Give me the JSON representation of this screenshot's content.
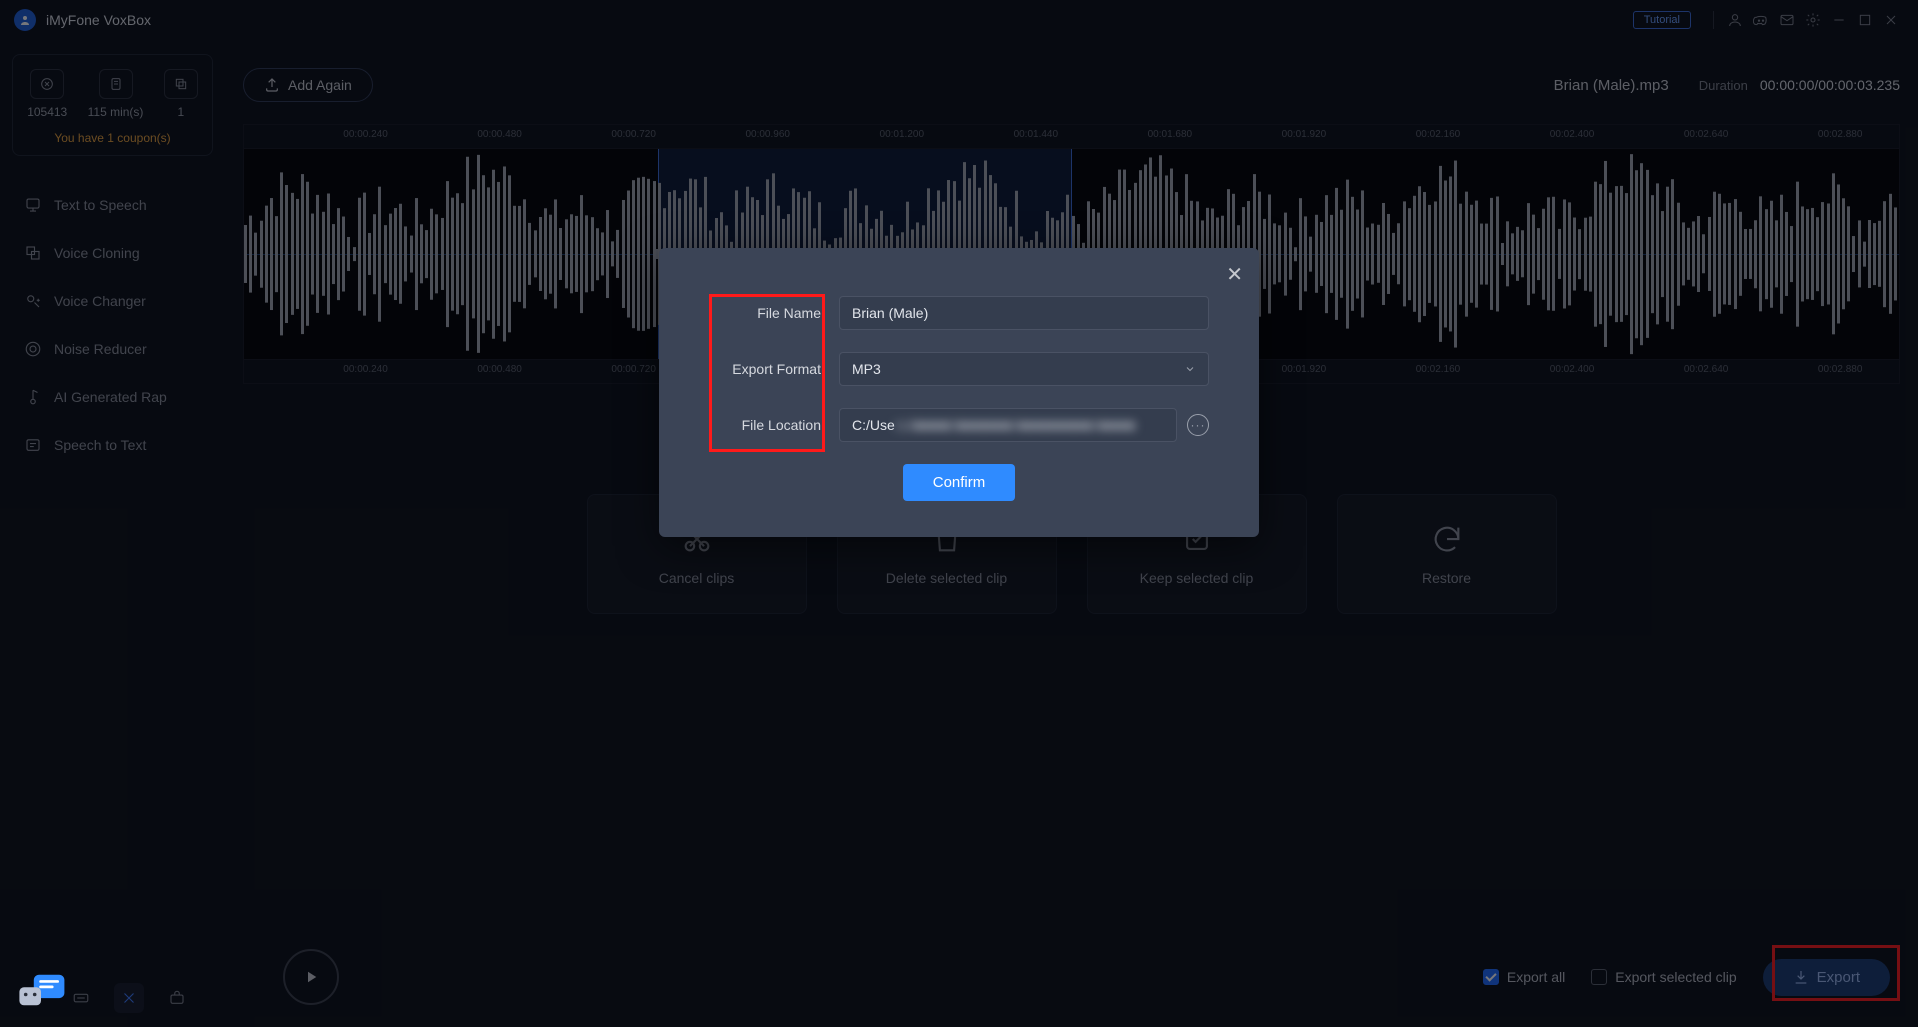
{
  "app": {
    "title": "iMyFone VoxBox",
    "tutorial_label": "Tutorial"
  },
  "sidebar": {
    "stats": [
      {
        "value": "105413"
      },
      {
        "value": "115 min(s)"
      },
      {
        "value": "1"
      }
    ],
    "coupon_text": "You have 1 coupon(s)",
    "items": [
      {
        "label": "Text to Speech"
      },
      {
        "label": "Voice Cloning"
      },
      {
        "label": "Voice Changer"
      },
      {
        "label": "Noise Reducer"
      },
      {
        "label": "AI Generated Rap"
      },
      {
        "label": "Speech to Text"
      }
    ]
  },
  "main": {
    "add_again_label": "Add Again",
    "track_name": "Brian (Male).mp3",
    "duration_label": "Duration",
    "duration_value": "00:00:00/00:00:03.235",
    "ruler_ticks": [
      "00:00.240",
      "00:00.480",
      "00:00.720",
      "00:00.960",
      "00:01.200",
      "00:01.440",
      "00:01.680",
      "00:01.920",
      "00:02.160",
      "00:02.400",
      "00:02.640",
      "00:02.880"
    ],
    "actions": [
      {
        "label": "Cancel clips"
      },
      {
        "label": "Delete selected clip"
      },
      {
        "label": "Keep selected clip"
      },
      {
        "label": "Restore"
      }
    ],
    "export_all_label": "Export all",
    "export_selected_label": "Export selected clip",
    "export_button_label": "Export"
  },
  "modal": {
    "file_name_label": "File Name",
    "file_name_value": "Brian (Male)",
    "export_format_label": "Export Format",
    "export_format_value": "MP3",
    "file_location_label": "File Location",
    "file_location_prefix": "C:/Use",
    "confirm_label": "Confirm"
  }
}
